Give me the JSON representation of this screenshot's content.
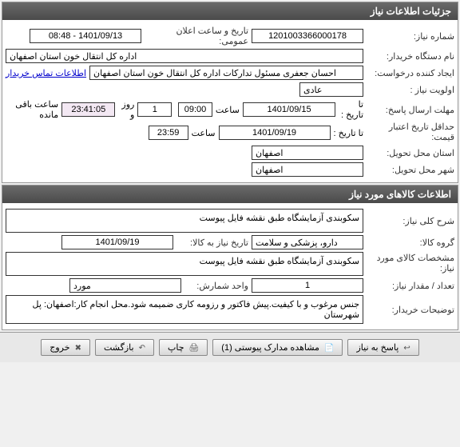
{
  "panel1": {
    "title": "جزئیات اطلاعات نیاز",
    "req_number_label": "شماره نیاز:",
    "req_number": "1201003366000178",
    "announce_label": "تاریخ و ساعت اعلان عمومی:",
    "announce_value": "1401/09/13 - 08:48",
    "buyer_label": "نام دستگاه خریدار:",
    "buyer_value": "اداره کل انتقال خون استان اصفهان",
    "creator_label": "ایجاد کننده درخواست:",
    "creator_value": "احسان جعفری مسئول تدارکات اداره کل انتقال خون استان اصفهان",
    "contact_link": "اطلاعات تماس خریدار",
    "priority_label": "اولویت نیاز :",
    "priority_value": "عادی",
    "deadline_label": "مهلت ارسال پاسخ:",
    "to_date_label": "تا تاریخ :",
    "deadline_date": "1401/09/15",
    "time_label": "ساعت",
    "deadline_time": "09:00",
    "days_value": "1",
    "days_unit_label": "روز و",
    "countdown": "23:41:05",
    "remaining_label": "ساعت باقی مانده",
    "validity_label": "حداقل تاریخ اعتبار قیمت:",
    "validity_date": "1401/09/19",
    "validity_time": "23:59",
    "province_label": "استان محل تحویل:",
    "province_value": "اصفهان",
    "city_label": "شهر محل تحویل:",
    "city_value": "اصفهان"
  },
  "panel2": {
    "title": "اطلاعات کالاهای مورد نیاز",
    "desc_label": "شرح کلی نیاز:",
    "desc_value": "سکوبندی آزمایشگاه طبق نقشه فایل پیوست",
    "group_label": "گروه کالا:",
    "group_value": "دارو، پزشکی و سلامت",
    "need_date_label": "تاریخ نیاز به کالا:",
    "need_date_value": "1401/09/19",
    "spec_label": "مشخصات کالای مورد نیاز:",
    "spec_value": "سکوبندی آزمایشگاه طبق نقشه فایل پیوست",
    "qty_label": "تعداد / مقدار نیاز:",
    "qty_value": "1",
    "unit_label": "واحد شمارش:",
    "unit_value": "مورد",
    "notes_label": "توضیحات خریدار:",
    "notes_value": "جنس مرغوب و با کیفیت.پیش فاکتور و رزومه کاری ضمیمه شود.محل انجام کار:اصفهان: پل شهرستان"
  },
  "buttons": {
    "respond": "پاسخ به نیاز",
    "attachments": "مشاهده مدارک پیوستی (1)",
    "print": "چاپ",
    "back": "بازگشت",
    "exit": "خروج"
  }
}
